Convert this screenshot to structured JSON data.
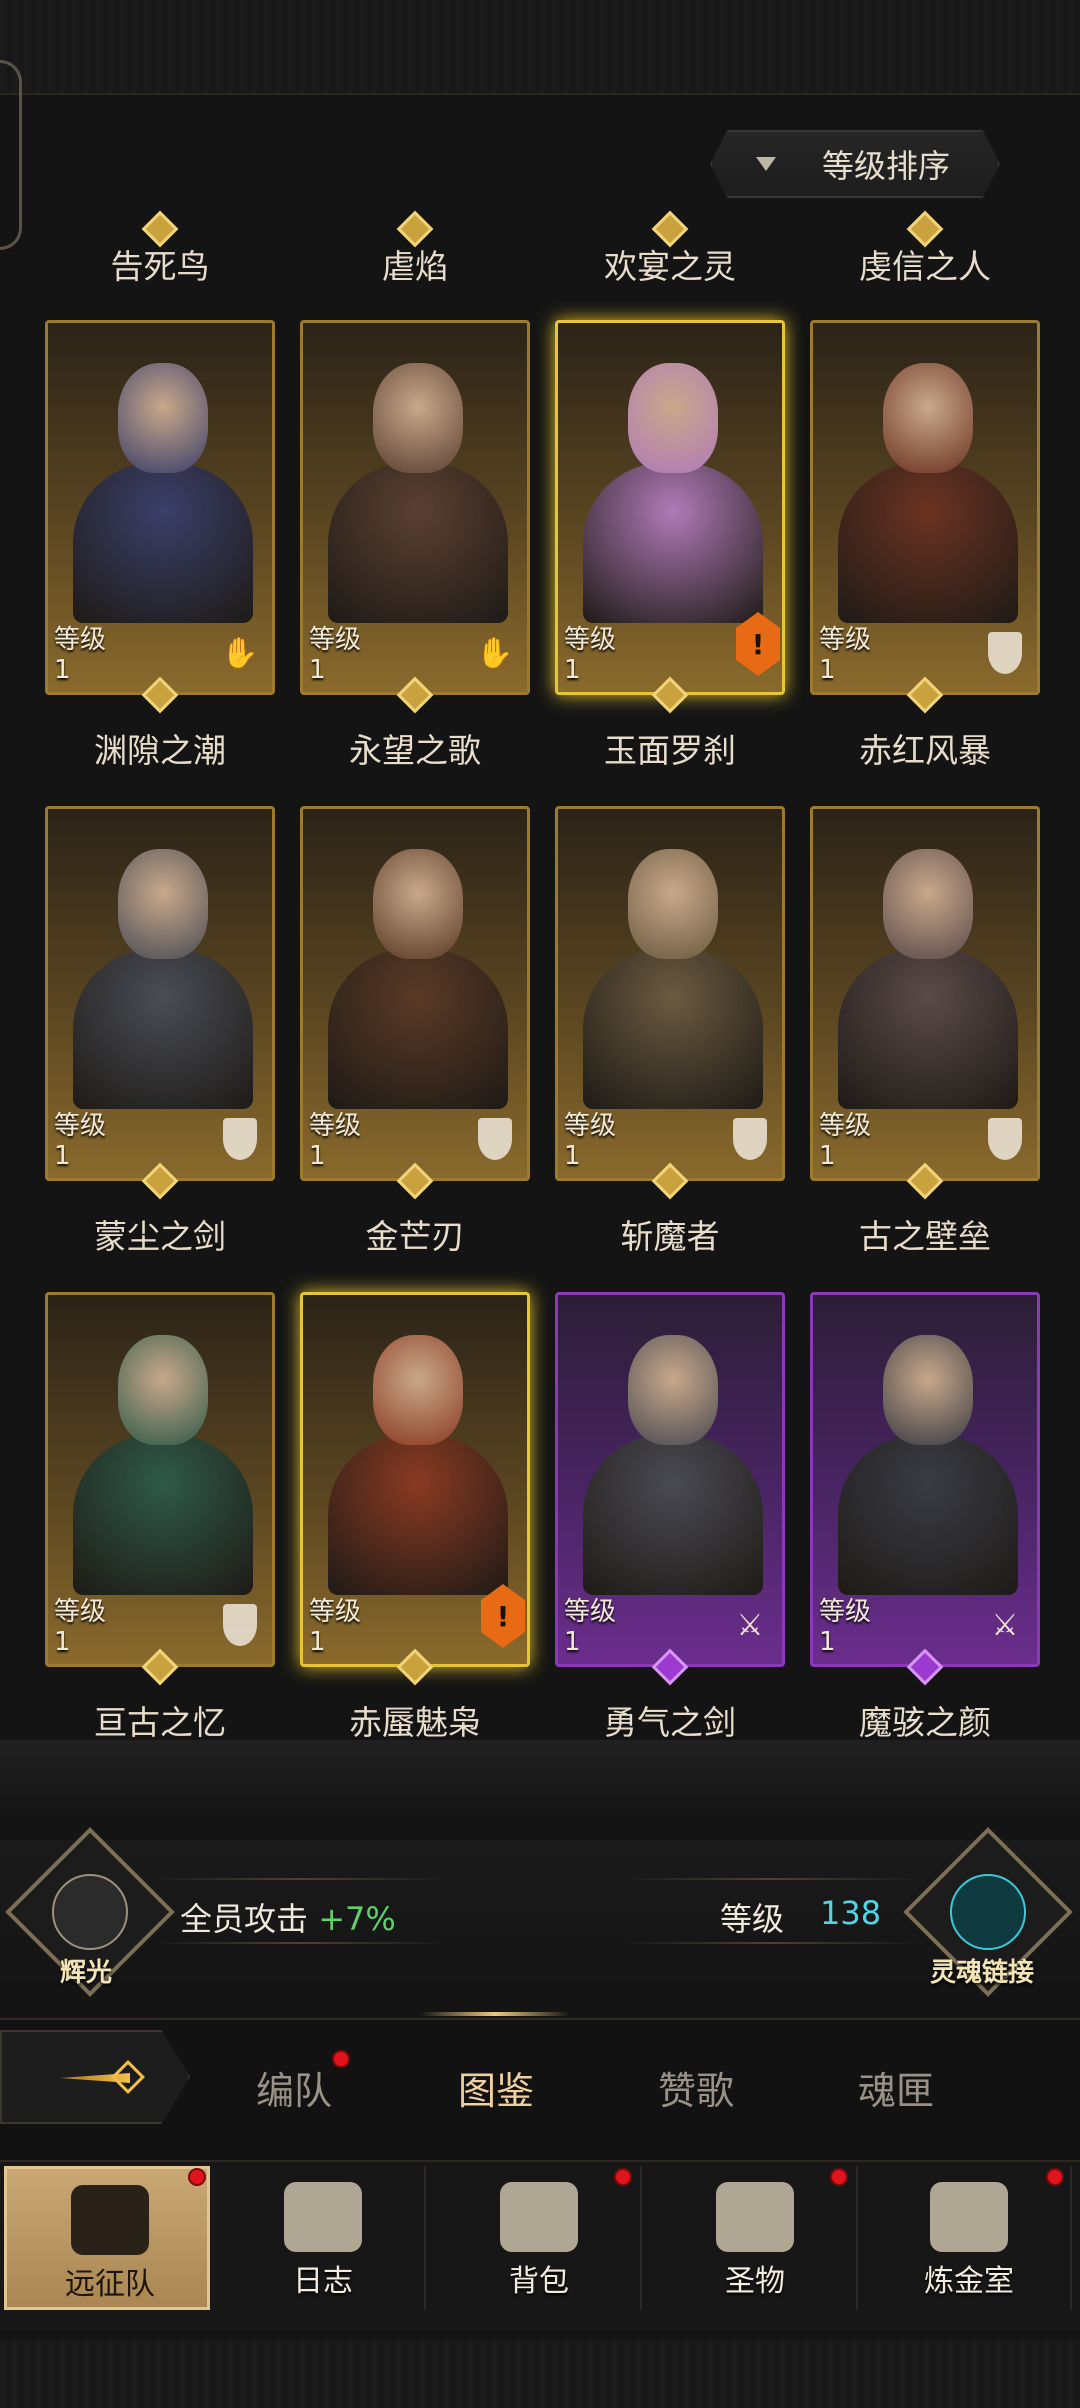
{
  "sort": {
    "label": "等级排序"
  },
  "level_label": "等级",
  "rows": [
    [
      {
        "name": "告死鸟",
        "level": "1",
        "rarity": "gold",
        "class_icon": "hand-icon",
        "accent": "#3b3f6a"
      },
      {
        "name": "虐焰",
        "level": "1",
        "rarity": "gold",
        "class_icon": "hand-icon",
        "accent": "#5a4032"
      },
      {
        "name": "欢宴之灵",
        "level": "1",
        "rarity": "gold-glow",
        "class_icon": "orange-hex-icon",
        "accent": "#b07ab8"
      },
      {
        "name": "虔信之人",
        "level": "1",
        "rarity": "gold",
        "class_icon": "shield-icon",
        "accent": "#6b3322"
      }
    ],
    [
      {
        "name": "渊隙之潮",
        "level": "1",
        "rarity": "gold",
        "class_icon": "shield-icon",
        "accent": "#4a4d55"
      },
      {
        "name": "永望之歌",
        "level": "1",
        "rarity": "gold",
        "class_icon": "shield-icon",
        "accent": "#5a3a26"
      },
      {
        "name": "玉面罗刹",
        "level": "1",
        "rarity": "gold",
        "class_icon": "shield-icon",
        "accent": "#6a5a40"
      },
      {
        "name": "赤红风暴",
        "level": "1",
        "rarity": "gold",
        "class_icon": "shield-icon",
        "accent": "#5a4a4a"
      }
    ],
    [
      {
        "name": "蒙尘之剑",
        "level": "1",
        "rarity": "gold",
        "class_icon": "shield-icon",
        "accent": "#2f5a48"
      },
      {
        "name": "金芒刃",
        "level": "1",
        "rarity": "gold-glow",
        "class_icon": "orange-hex-icon",
        "accent": "#8a3a22"
      },
      {
        "name": "斩魔者",
        "level": "1",
        "rarity": "purple",
        "class_icon": "sword-icon",
        "accent": "#4a4a52"
      },
      {
        "name": "古之壁垒",
        "level": "1",
        "rarity": "purple",
        "class_icon": "sword-icon",
        "accent": "#3a3c44"
      }
    ]
  ],
  "row_bottom_names": [
    [
      "渊隙之潮",
      "永望之歌",
      "玉面罗刹",
      "赤红风暴"
    ],
    [
      "蒙尘之剑",
      "金芒刃",
      "斩魔者",
      "古之壁垒"
    ],
    [
      "亘古之忆",
      "赤蜃魅枭",
      "勇气之剑",
      "魔骇之颜"
    ]
  ],
  "top_names": [
    "告死鸟",
    "虐焰",
    "欢宴之灵",
    "虔信之人"
  ],
  "bonus": {
    "left_caption": "辉光",
    "stat_label": "全员攻击",
    "stat_value": "+7%",
    "level_label": "等级",
    "level_value": "138",
    "right_caption": "灵魂链接"
  },
  "tabs": [
    "编队",
    "图鉴",
    "赞歌",
    "魂匣"
  ],
  "nav": [
    "远征队",
    "日志",
    "背包",
    "圣物",
    "炼金室"
  ]
}
